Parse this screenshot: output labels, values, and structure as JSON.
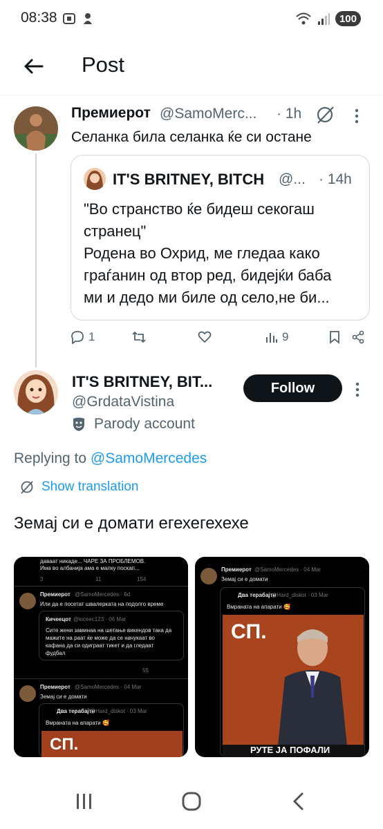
{
  "status_bar": {
    "time": "08:38",
    "battery": "100"
  },
  "header": {
    "title": "Post"
  },
  "parent_tweet": {
    "author": "Премиерот",
    "handle": "@SamoMerc...",
    "time": "1h",
    "text": "Селанка била селанка ќе си остане",
    "quote": {
      "author": "IT'S BRITNEY, BITCH",
      "handle": "@...",
      "time": "14h",
      "lines": [
        "\"Во странство ќе бидеш секогаш",
        "странец\"",
        "Родена во Охрид, ме гледаа како",
        "граѓанин од втор ред, бидејќи баба",
        "ми и дедо ми биле од село,не би..."
      ]
    },
    "actions": {
      "replies": "1",
      "views": "9"
    }
  },
  "main_tweet": {
    "author": "IT'S BRITNEY, BIT...",
    "handle": "@GrdataVistina",
    "parody_label": "Parody account",
    "follow_label": "Follow",
    "replying_prefix": "Replying to ",
    "replying_mention": "@SamoMercedes",
    "translate_label": "Show translation",
    "text": "Земај си е домати егехегехехе"
  },
  "media": {
    "img1": {
      "top_text_1": "даваат никаде... ЧАРЕ ЗА ПРОБЛЕМОВ.",
      "top_text_2": "Има во албанија ама е малку поскап...",
      "top_counts": [
        "3",
        "11",
        "154"
      ],
      "t1_name": "Премиерот",
      "t1_handle": "@SamoMercedes · 6d",
      "t1_text": "Или да е посетат швалерката на подолго време",
      "q_name": "Кичеецот",
      "q_handle": "@kiceec123 · 06 Mar",
      "q_lines": [
        "Сите жени заминаа на шетање викендов така да",
        "мажите на раат ќе може да се начукаат во",
        "кафана да си одиграат тикет и да гледаат",
        "фудбал"
      ],
      "t1_views": "55",
      "t2_name": "Премиерот",
      "t2_handle": "@SamoMercedes · 04 Mar",
      "t2_text": "Земај си е домати",
      "q2_name": "Два терабајти",
      "q2_handle": "@Hard_diskot · 03 Mar",
      "q2_text": "Вмраната на апарати 🥰",
      "photo_text": "СП."
    },
    "img2": {
      "t_name": "Премиерот",
      "t_handle": "@SamoMercedes · 04 Mar",
      "t_text": "Земај си е домати",
      "q_name": "Два терабајти",
      "q_handle": "@Hard_diskot · 03 Mar",
      "q_text": "Вмраната на апарати 🥰",
      "photo_text": "СП.",
      "caption": "РУТЕ ЈА ПОФАЛИ"
    }
  }
}
